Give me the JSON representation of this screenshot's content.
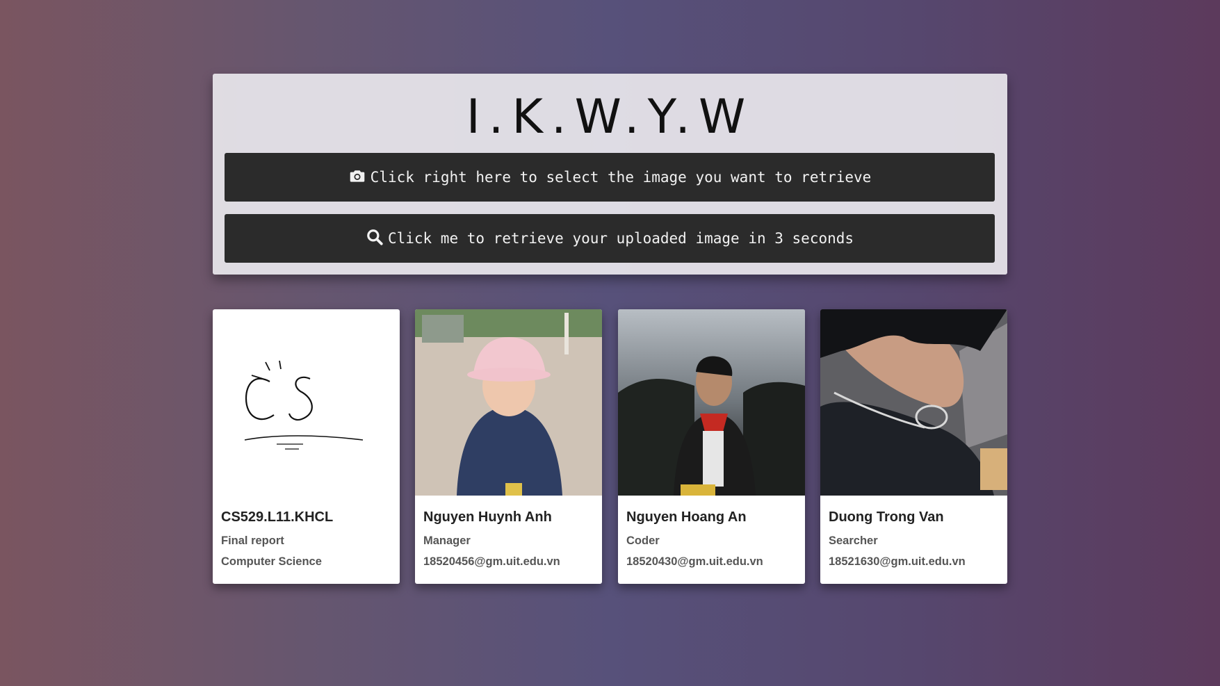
{
  "header": {
    "title": "I.K.W.Y.W",
    "select_label": "Click right here to select the image you want to retrieve",
    "retrieve_label": "Click me to retrieve your uploaded image in 3 seconds"
  },
  "cards": [
    {
      "name": "CS529.L11.KHCL",
      "line1": "Final report",
      "line2": "Computer Science",
      "logo": "CS"
    },
    {
      "name": "Nguyen Huynh Anh",
      "line1": "Manager",
      "line2": "18520456@gm.uit.edu.vn"
    },
    {
      "name": "Nguyen Hoang An",
      "line1": "Coder",
      "line2": "18520430@gm.uit.edu.vn"
    },
    {
      "name": "Duong Trong Van",
      "line1": "Searcher",
      "line2": "18521630@gm.uit.edu.vn"
    }
  ],
  "icons": {
    "select": "camera-icon",
    "retrieve": "search-icon"
  }
}
